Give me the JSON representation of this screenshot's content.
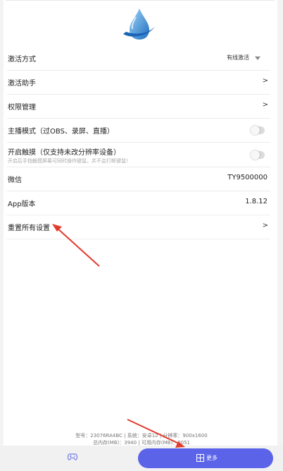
{
  "settings": {
    "activation_method": {
      "label": "激活方式",
      "value": "有线激活"
    },
    "activation_helper": {
      "label": "激活助手",
      "chevron": ">"
    },
    "permission_mgmt": {
      "label": "权限管理",
      "chevron": ">"
    },
    "streamer_mode": {
      "label": "主播模式（过OBS、录屏、直播）",
      "enabled": false
    },
    "touch": {
      "label": "开启触摸（仅支持未改分辨率设备）",
      "hint": "开启后手指触摸屏幕可同时操作键鼠，并不会打断键鼠!",
      "enabled": false
    },
    "wechat": {
      "label": "微信",
      "value": "TY9500000"
    },
    "app_version": {
      "label": "App版本",
      "value": "1.8.12"
    },
    "reset_all": {
      "label": "重置所有设置",
      "chevron": ">"
    }
  },
  "footer": {
    "line1": "型号：23076RA4BC | 系统：安卓12 | 分辨率：900x1600",
    "line2": "总内存(MB)：3940 | 可用内存(MB)：2051"
  },
  "tabbar": {
    "more_label": "更多"
  },
  "colors": {
    "accent": "#5b63e8",
    "arrow": "#e23b2e",
    "logo_blue": "#2f8fd8"
  },
  "icons": {
    "logo": "water-drop-logo",
    "gamepad": "gamepad-icon",
    "grid": "grid-icon"
  }
}
